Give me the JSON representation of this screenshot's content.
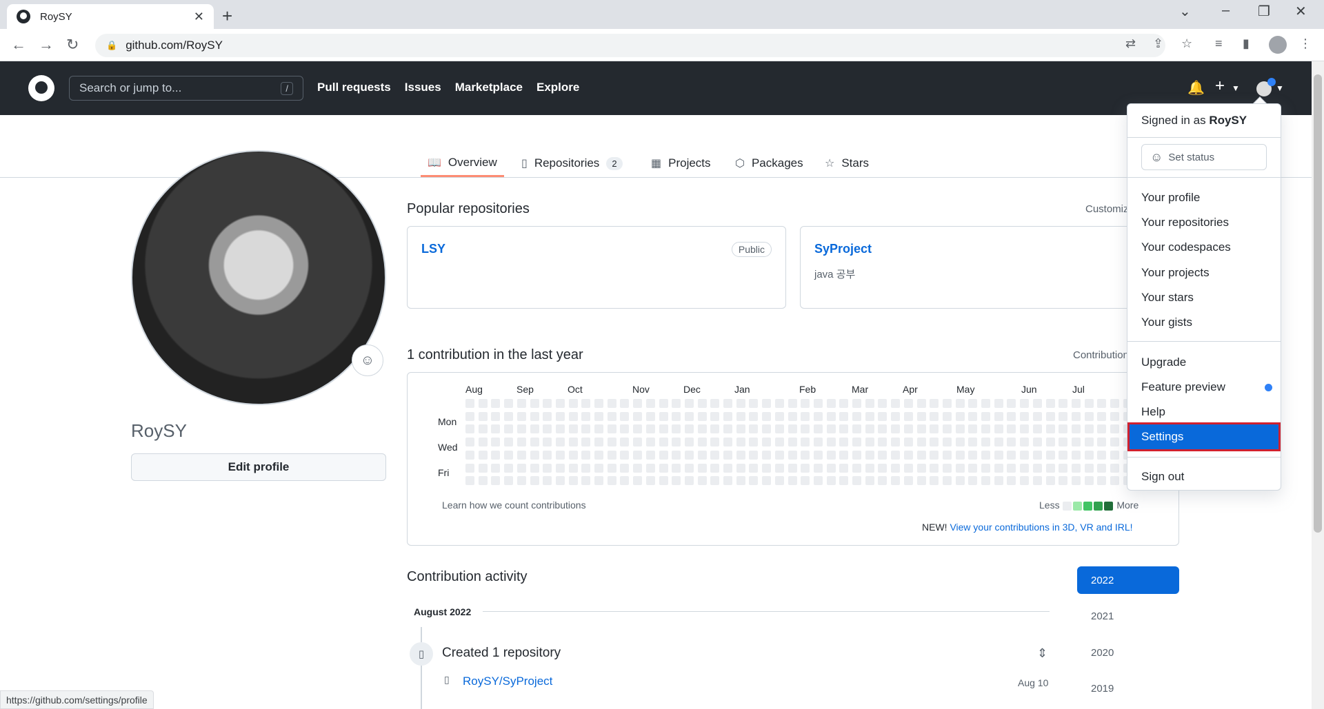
{
  "browser": {
    "tab_title": "RoySY",
    "url": "github.com/RoySY",
    "status_url": "https://github.com/settings/profile"
  },
  "header": {
    "search_placeholder": "Search or jump to...",
    "search_shortcut": "/",
    "nav": [
      "Pull requests",
      "Issues",
      "Marketplace",
      "Explore"
    ],
    "plus": "+"
  },
  "profile_nav": {
    "tabs": [
      {
        "label": "Overview",
        "icon": "book-icon"
      },
      {
        "label": "Repositories",
        "icon": "repo-icon",
        "count": "2"
      },
      {
        "label": "Projects",
        "icon": "table-icon"
      },
      {
        "label": "Packages",
        "icon": "package-icon"
      },
      {
        "label": "Stars",
        "icon": "star-icon"
      }
    ]
  },
  "profile": {
    "username": "RoySY",
    "edit_label": "Edit profile"
  },
  "popular": {
    "heading": "Popular repositories",
    "customize": "Customiz",
    "repos": [
      {
        "name": "LSY",
        "badge": "Public",
        "desc": ""
      },
      {
        "name": "SyProject",
        "badge": "",
        "desc": "java 공부"
      }
    ]
  },
  "contributions": {
    "heading": "1 contribution in the last year",
    "settings": "Contribution",
    "months": [
      "Aug",
      "Sep",
      "Oct",
      "Nov",
      "Dec",
      "Jan",
      "Feb",
      "Mar",
      "Apr",
      "May",
      "Jun",
      "Jul"
    ],
    "days": [
      "Mon",
      "Wed",
      "Fri"
    ],
    "learn": "Learn how we count contributions",
    "less": "Less",
    "more": "More",
    "new_prefix": "NEW!",
    "new_link": "View your contributions in 3D, VR and IRL!",
    "legend_colors": [
      "#ebedf0",
      "#9be9a8",
      "#40c463",
      "#30a14e",
      "#216e39"
    ]
  },
  "activity": {
    "heading": "Contribution activity",
    "period": "August 2022",
    "event": "Created 1 repository",
    "repo": "RoySY/SyProject",
    "date": "Aug 10",
    "years": [
      "2022",
      "2021",
      "2020",
      "2019"
    ]
  },
  "dropdown": {
    "signed_in_prefix": "Signed in as",
    "signed_in_user": "RoySY",
    "set_status": "Set status",
    "group1": [
      "Your profile",
      "Your repositories",
      "Your codespaces",
      "Your projects",
      "Your stars",
      "Your gists"
    ],
    "group2": [
      "Upgrade",
      "Feature preview",
      "Help",
      "Settings"
    ],
    "sign_out": "Sign out"
  }
}
